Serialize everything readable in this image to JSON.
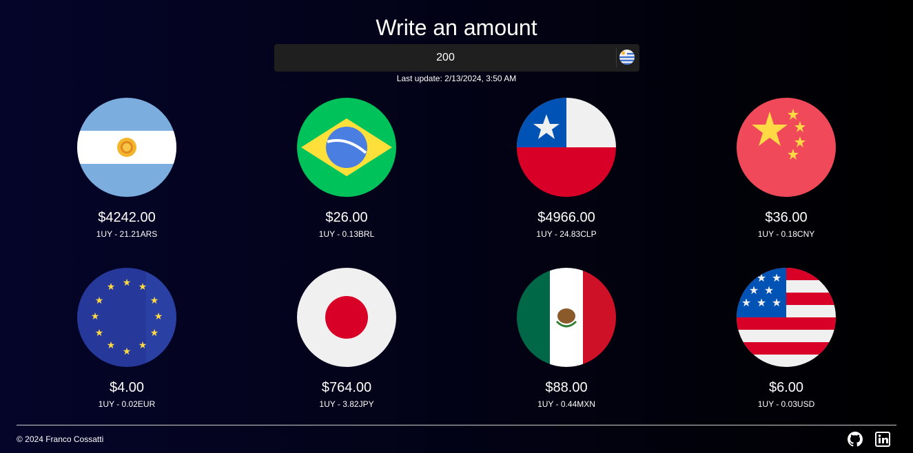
{
  "header": {
    "title": "Write an amount",
    "amount_value": "200",
    "base_flag_icon": "uruguay-flag-icon",
    "last_update": "Last update: 2/13/2024, 3:50 AM"
  },
  "currencies": [
    {
      "flag_icon": "argentina-flag-icon",
      "value": "$4242.00",
      "rate": "1UY - 21.21ARS"
    },
    {
      "flag_icon": "brazil-flag-icon",
      "value": "$26.00",
      "rate": "1UY - 0.13BRL"
    },
    {
      "flag_icon": "chile-flag-icon",
      "value": "$4966.00",
      "rate": "1UY - 24.83CLP"
    },
    {
      "flag_icon": "china-flag-icon",
      "value": "$36.00",
      "rate": "1UY - 0.18CNY"
    },
    {
      "flag_icon": "european-union-flag-icon",
      "value": "$4.00",
      "rate": "1UY - 0.02EUR"
    },
    {
      "flag_icon": "japan-flag-icon",
      "value": "$764.00",
      "rate": "1UY - 3.82JPY"
    },
    {
      "flag_icon": "mexico-flag-icon",
      "value": "$88.00",
      "rate": "1UY - 0.44MXN"
    },
    {
      "flag_icon": "usa-flag-icon",
      "value": "$6.00",
      "rate": "1UY - 0.03USD"
    }
  ],
  "footer": {
    "copyright": "© 2024 Franco Cossatti",
    "icons": [
      "github-icon",
      "linkedin-icon"
    ]
  },
  "colors": {
    "background_start": "#05052a",
    "background_end": "#000000",
    "input_background": "#1f1f1f",
    "text": "#ffffff"
  }
}
